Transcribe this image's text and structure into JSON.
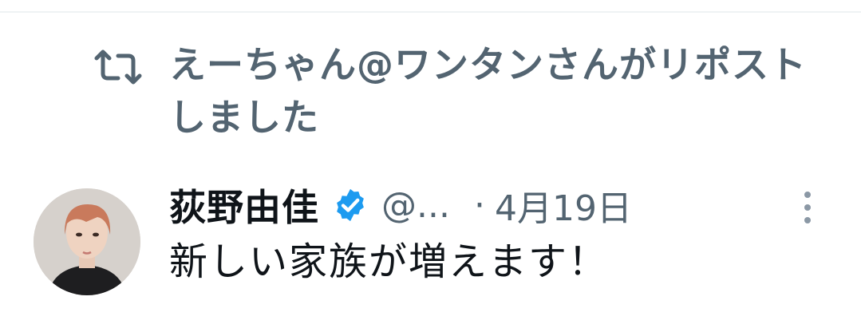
{
  "repost": {
    "text": "えーちゃん@ワンタンさんがリポストしました",
    "icon": "repost-icon"
  },
  "tweet": {
    "author": {
      "name": "荻野由佳",
      "handle": "@...",
      "verified": true,
      "avatar_icon": "avatar"
    },
    "separator": "·",
    "date": "4月19日",
    "text": "新しい家族が増えます！",
    "more_icon": "more-dots-icon"
  },
  "colors": {
    "primary_text": "#0f1419",
    "secondary_text": "#536471",
    "verified_blue": "#1d9bf0",
    "divider": "#eff3f4",
    "background": "#ffffff"
  }
}
